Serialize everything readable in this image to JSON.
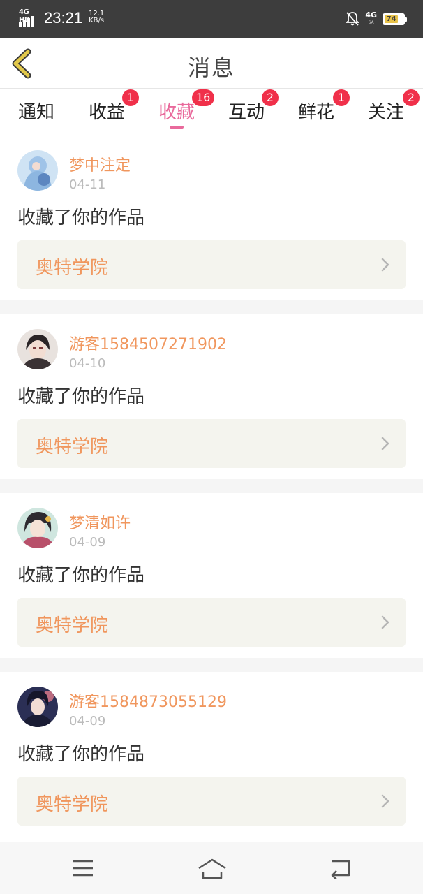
{
  "status_bar": {
    "network": "4G HD",
    "time": "23:21",
    "speed_value": "12.1",
    "speed_unit": "KB/s",
    "net2": "4G",
    "net2_sub": "SA",
    "battery": "74"
  },
  "header": {
    "title": "消息"
  },
  "tabs": [
    {
      "label": "通知",
      "badge": "",
      "active": false
    },
    {
      "label": "收益",
      "badge": "1",
      "active": false
    },
    {
      "label": "收藏",
      "badge": "16",
      "active": true
    },
    {
      "label": "互动",
      "badge": "2",
      "active": false
    },
    {
      "label": "鲜花",
      "badge": "1",
      "active": false
    },
    {
      "label": "关注",
      "badge": "2",
      "active": false
    }
  ],
  "items": [
    {
      "username": "梦中注定",
      "date": "04-11",
      "action": "收藏了你的作品",
      "work": "奥特学院"
    },
    {
      "username": "游客1584507271902",
      "date": "04-10",
      "action": "收藏了你的作品",
      "work": "奥特学院"
    },
    {
      "username": "梦清如许",
      "date": "04-09",
      "action": "收藏了你的作品",
      "work": "奥特学院"
    },
    {
      "username": "游客1584873055129",
      "date": "04-09",
      "action": "收藏了你的作品",
      "work": "奥特学院"
    }
  ],
  "colors": {
    "accent": "#e96a9c",
    "username": "#f0965d",
    "badge": "#f0304a",
    "back_arrow": "#e2c84a"
  }
}
